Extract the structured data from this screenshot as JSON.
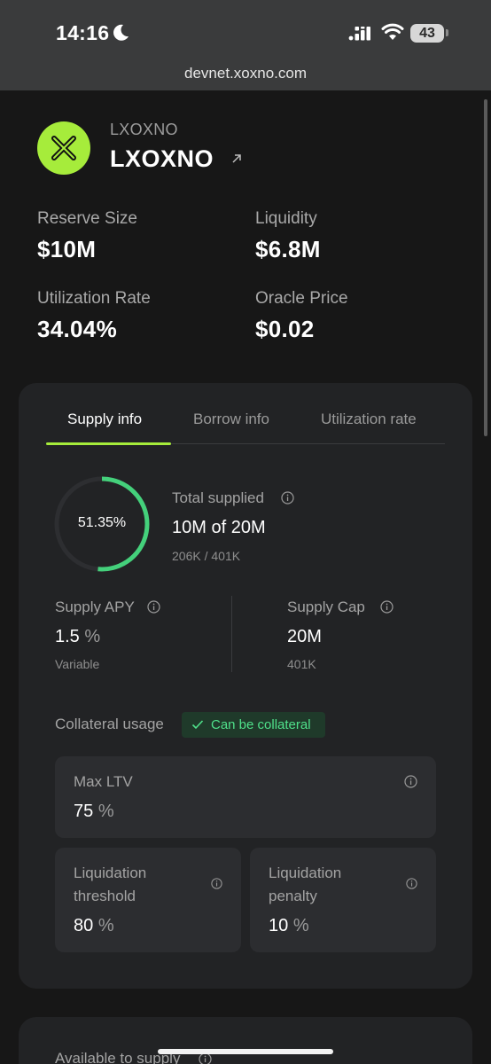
{
  "status_bar": {
    "time": "14:16",
    "battery": "43"
  },
  "browser": {
    "url": "devnet.xoxno.com"
  },
  "asset": {
    "symbol_small": "LXOXNO",
    "symbol_large": "LXOXNO"
  },
  "stats": [
    {
      "label": "Reserve Size",
      "value": "$10M"
    },
    {
      "label": "Liquidity",
      "value": "$6.8M"
    },
    {
      "label": "Utilization Rate",
      "value": "34.04%"
    },
    {
      "label": "Oracle Price",
      "value": "$0.02"
    }
  ],
  "tabs": [
    {
      "label": "Supply info",
      "active": true
    },
    {
      "label": "Borrow info",
      "active": false
    },
    {
      "label": "Utilization rate",
      "active": false
    }
  ],
  "supply": {
    "ring_percent_label": "51.35%",
    "ring_fraction": 0.5135,
    "total_supplied_label": "Total supplied",
    "total_supplied_value": "10M of 20M",
    "total_supplied_sub": "206K / 401K",
    "apy_label": "Supply APY",
    "apy_value": "1.5",
    "apy_unit": "%",
    "apy_sub": "Variable",
    "cap_label": "Supply Cap",
    "cap_value": "20M",
    "cap_sub": "401K"
  },
  "collateral": {
    "label": "Collateral usage",
    "badge": "Can be collateral",
    "max_ltv_label": "Max LTV",
    "max_ltv_value": "75",
    "liq_threshold_label_1": "Liquidation",
    "liq_threshold_label_2": "threshold",
    "liq_threshold_value": "80",
    "liq_penalty_label_1": "Liquidation",
    "liq_penalty_label_2": "penalty",
    "liq_penalty_value": "10",
    "unit": "%"
  },
  "available": {
    "label": "Available to supply"
  },
  "colors": {
    "accent": "#a6ec3b",
    "ring": "#44d07b",
    "badge_text": "#4fe08a",
    "background": "#171717",
    "card": "#222325"
  },
  "icons": [
    "moon-icon",
    "cellular-signal-icon",
    "wifi-icon",
    "battery-icon",
    "xoxno-logo-icon",
    "external-link-icon",
    "info-icon",
    "check-icon"
  ]
}
